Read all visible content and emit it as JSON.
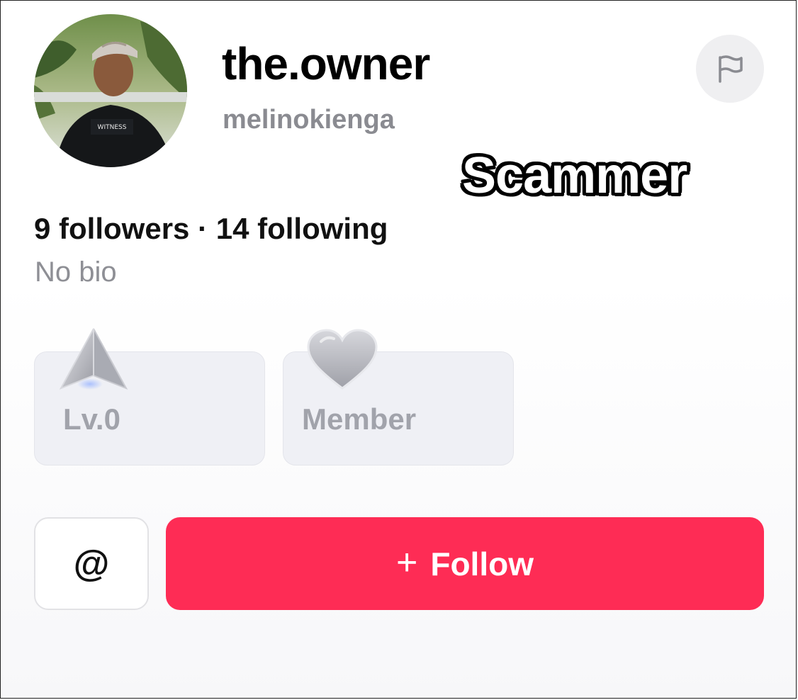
{
  "profile": {
    "display_name": "the.owner",
    "username": "melinokienga",
    "stats": "9 followers · 14 following",
    "bio": "No bio"
  },
  "overlay": {
    "caption": "Scammer"
  },
  "badges": [
    {
      "label": "Lv.0",
      "icon": "level-arrow-icon"
    },
    {
      "label": "Member",
      "icon": "heart-icon"
    }
  ],
  "actions": {
    "mention_label": "@",
    "follow_label": "Follow",
    "follow_icon": "+"
  },
  "colors": {
    "follow_button": "#fe2c55",
    "muted_text": "#8a8b91",
    "badge_bg": "#eff0f5"
  }
}
